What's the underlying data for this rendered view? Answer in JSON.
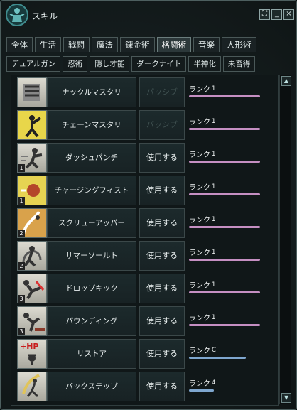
{
  "window": {
    "title": "スキル",
    "buttons": [
      "⛶",
      "_",
      "×"
    ]
  },
  "tabs_row1": [
    {
      "label": "全体"
    },
    {
      "label": "生活"
    },
    {
      "label": "戦闘"
    },
    {
      "label": "魔法"
    },
    {
      "label": "錬金術"
    },
    {
      "label": "格闘術",
      "active": true
    },
    {
      "label": "音楽"
    },
    {
      "label": "人形術"
    }
  ],
  "tabs_row2": [
    {
      "label": "デュアルガン"
    },
    {
      "label": "忍術"
    },
    {
      "label": "隠し才能"
    },
    {
      "label": "ダークナイト"
    },
    {
      "label": "半神化"
    },
    {
      "label": "未習得"
    }
  ],
  "colors": {
    "rank_bar_pink": "#c58fc2",
    "rank_bar_blue": "#7fa7cf"
  },
  "skills": [
    {
      "name": "ナックルマスタリ",
      "use_label": "パッシブ",
      "passive": true,
      "rank_label": "ランク",
      "rank": "1",
      "bar_color": "pink",
      "level": "",
      "icon": "knuckle-mastery-icon"
    },
    {
      "name": "チェーンマスタリ",
      "use_label": "パッシブ",
      "passive": true,
      "rank_label": "ランク",
      "rank": "1",
      "bar_color": "pink",
      "level": "",
      "icon": "chain-mastery-icon"
    },
    {
      "name": "ダッシュパンチ",
      "use_label": "使用する",
      "passive": false,
      "rank_label": "ランク",
      "rank": "1",
      "bar_color": "pink",
      "level": "1",
      "icon": "dash-punch-icon"
    },
    {
      "name": "チャージングフィスト",
      "use_label": "使用する",
      "passive": false,
      "rank_label": "ランク",
      "rank": "1",
      "bar_color": "pink",
      "level": "1",
      "icon": "charging-fist-icon"
    },
    {
      "name": "スクリューアッパー",
      "use_label": "使用する",
      "passive": false,
      "rank_label": "ランク",
      "rank": "1",
      "bar_color": "pink",
      "level": "2",
      "icon": "screw-upper-icon"
    },
    {
      "name": "サマーソールト",
      "use_label": "使用する",
      "passive": false,
      "rank_label": "ランク",
      "rank": "1",
      "bar_color": "pink",
      "level": "2",
      "icon": "somersault-icon"
    },
    {
      "name": "ドロップキック",
      "use_label": "使用する",
      "passive": false,
      "rank_label": "ランク",
      "rank": "1",
      "bar_color": "pink",
      "level": "3",
      "icon": "drop-kick-icon"
    },
    {
      "name": "パウンディング",
      "use_label": "使用する",
      "passive": false,
      "rank_label": "ランク",
      "rank": "1",
      "bar_color": "pink",
      "level": "3",
      "icon": "pounding-icon"
    },
    {
      "name": "リストア",
      "use_label": "使用する",
      "passive": false,
      "rank_label": "ランク",
      "rank": "C",
      "bar_color": "blue",
      "level": "",
      "icon": "restore-icon",
      "icon_text": "+HP"
    },
    {
      "name": "バックステップ",
      "use_label": "使用する",
      "passive": false,
      "rank_label": "ランク",
      "rank": "4",
      "bar_color": "blue",
      "level": "",
      "icon": "back-step-icon"
    }
  ],
  "rank_progress": [
    1,
    1,
    1,
    1,
    1,
    1,
    1,
    1,
    0.8,
    0.35
  ]
}
